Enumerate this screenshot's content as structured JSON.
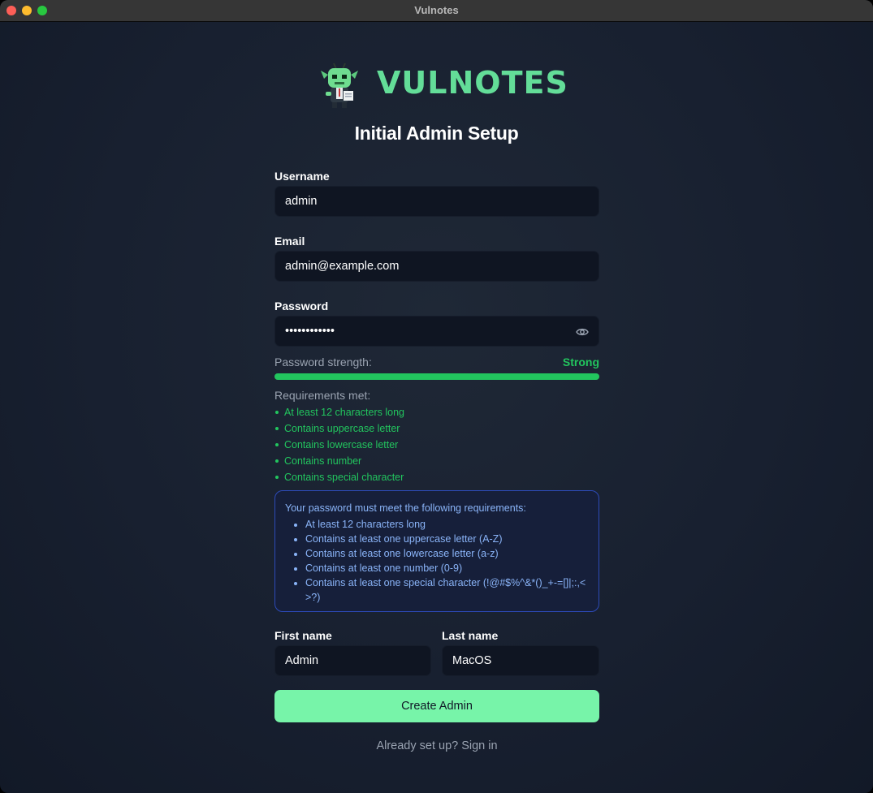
{
  "window": {
    "title": "Vulnotes"
  },
  "brand": {
    "name": "VULNOTES"
  },
  "page": {
    "title": "Initial Admin Setup"
  },
  "form": {
    "username": {
      "label": "Username",
      "value": "admin"
    },
    "email": {
      "label": "Email",
      "value": "admin@example.com"
    },
    "password": {
      "label": "Password",
      "value": "••••••••••••"
    },
    "strength": {
      "label": "Password strength:",
      "value": "Strong",
      "level_percent": 100
    },
    "requirements_met": {
      "title": "Requirements met:",
      "items": [
        "At least 12 characters long",
        "Contains uppercase letter",
        "Contains lowercase letter",
        "Contains number",
        "Contains special character"
      ]
    },
    "requirements_info": {
      "title": "Your password must meet the following requirements:",
      "items": [
        "At least 12 characters long",
        "Contains at least one uppercase letter (A-Z)",
        "Contains at least one lowercase letter (a-z)",
        "Contains at least one number (0-9)",
        "Contains at least one special character (!@#$%^&*()_+-=[]|;:,<>?)"
      ]
    },
    "first_name": {
      "label": "First name",
      "value": "Admin"
    },
    "last_name": {
      "label": "Last name",
      "value": "MacOS"
    },
    "submit_label": "Create Admin",
    "signin_link": "Already set up? Sign in"
  },
  "colors": {
    "accent": "#77f4a9",
    "brand": "#63dd98",
    "success": "#22c55e",
    "info": "#8ab4f8",
    "background": "#1b2331"
  },
  "icons": {
    "password_toggle": "eye-icon",
    "logo": "goblin-mascot-icon"
  }
}
